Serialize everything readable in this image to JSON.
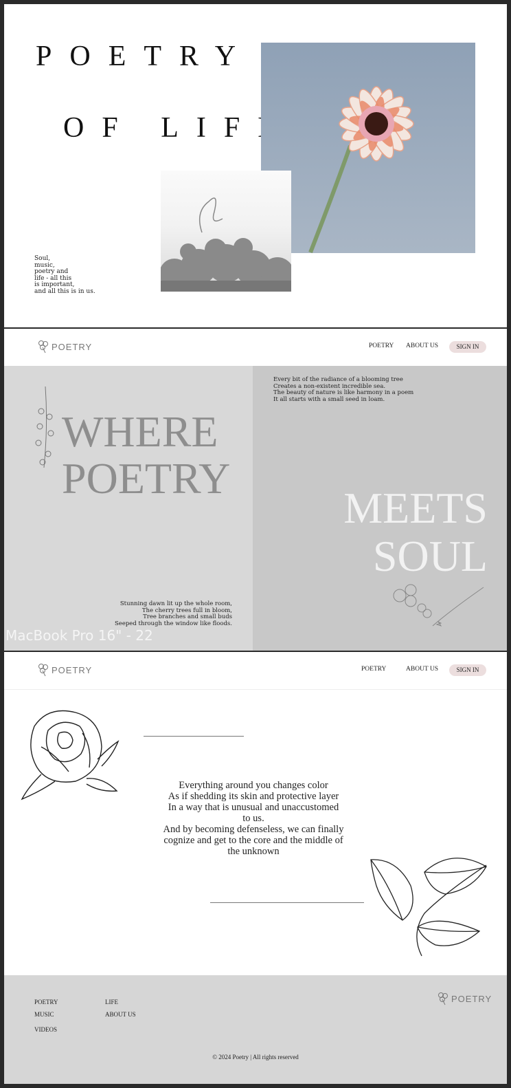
{
  "section1": {
    "title_line1": "POETRY",
    "title_line2": "OF LIFE",
    "soul_lines": [
      "Soul,",
      "music,",
      "poetry and",
      "life - all this",
      "is important,",
      "and all this is in us."
    ]
  },
  "section2": {
    "logo_text": "POETRY",
    "nav": {
      "poetry": "POETRY",
      "about": "ABOUT US",
      "signin": "SIGN IN"
    },
    "heading_left": [
      "WHERE",
      "POETRY"
    ],
    "heading_right": [
      "MEETS",
      "SOUL"
    ],
    "blooming_lines": [
      "Every bit of the radiance of a blooming tree",
      "Creates a non-existent incredible sea.",
      "The beauty of nature is like harmony in a poem",
      "It all starts with a small seed in loam."
    ],
    "dawn_lines": [
      "Stunning dawn lit up the whole room,",
      "The cherry trees full in bloom,",
      "Tree branches and small buds",
      "Seeped through the window like floods."
    ],
    "frame_label": "MacBook Pro 16\" - 22"
  },
  "section3": {
    "logo_text": "POETRY",
    "nav": {
      "poetry": "POETRY",
      "about": "ABOUT US",
      "signin": "SIGN IN"
    },
    "poem_lines": [
      "Everything around you changes color",
      "As if shedding its skin and protective layer",
      "In a way that is unusual and unaccustomed",
      "to us.",
      "And by becoming defenseless, we can finally",
      "cognize and get to the core and the middle of",
      "the unknown"
    ],
    "footer": {
      "col1": [
        "POETRY",
        "MUSIC",
        "VIDEOS"
      ],
      "col2": [
        "LIFE",
        "ABOUT US"
      ],
      "logo_text": "POETRY",
      "copyright": "© 2024 Poetry | All rights reserved"
    }
  }
}
